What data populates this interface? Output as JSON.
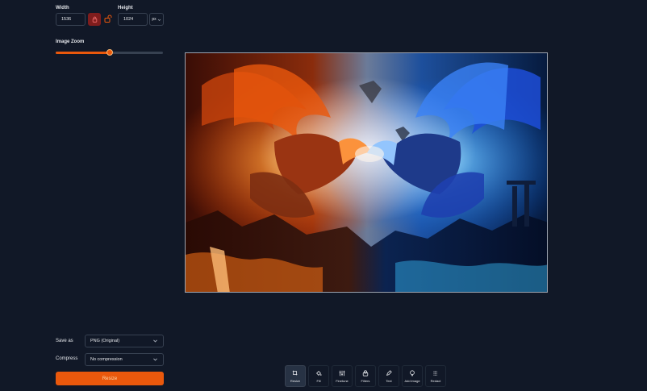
{
  "dimensions": {
    "width_label": "Width",
    "height_label": "Height",
    "width_value": "1536",
    "height_value": "1024",
    "unit": "px"
  },
  "zoom": {
    "label": "Image Zoom",
    "value_fraction": 0.5
  },
  "save_as": {
    "label": "Save as",
    "value": "PNG (Original)"
  },
  "compress": {
    "label": "Compress",
    "value": "No compression"
  },
  "resize_button": "Resize",
  "toolbar": [
    {
      "label": "Resize",
      "icon": "crop-icon",
      "active": true
    },
    {
      "label": "Fill",
      "icon": "bucket-icon",
      "active": false
    },
    {
      "label": "Finetune",
      "icon": "sliders-icon",
      "active": false
    },
    {
      "label": "Filters",
      "icon": "filters-icon",
      "active": false
    },
    {
      "label": "Text",
      "icon": "pen-icon",
      "active": false
    },
    {
      "label": "Add image",
      "icon": "image-icon",
      "active": false
    },
    {
      "label": "Redact",
      "icon": "redact-icon",
      "active": false
    }
  ],
  "colors": {
    "background": "#111827",
    "accent": "#ea580c",
    "lock_active": "#7f1d1d"
  }
}
